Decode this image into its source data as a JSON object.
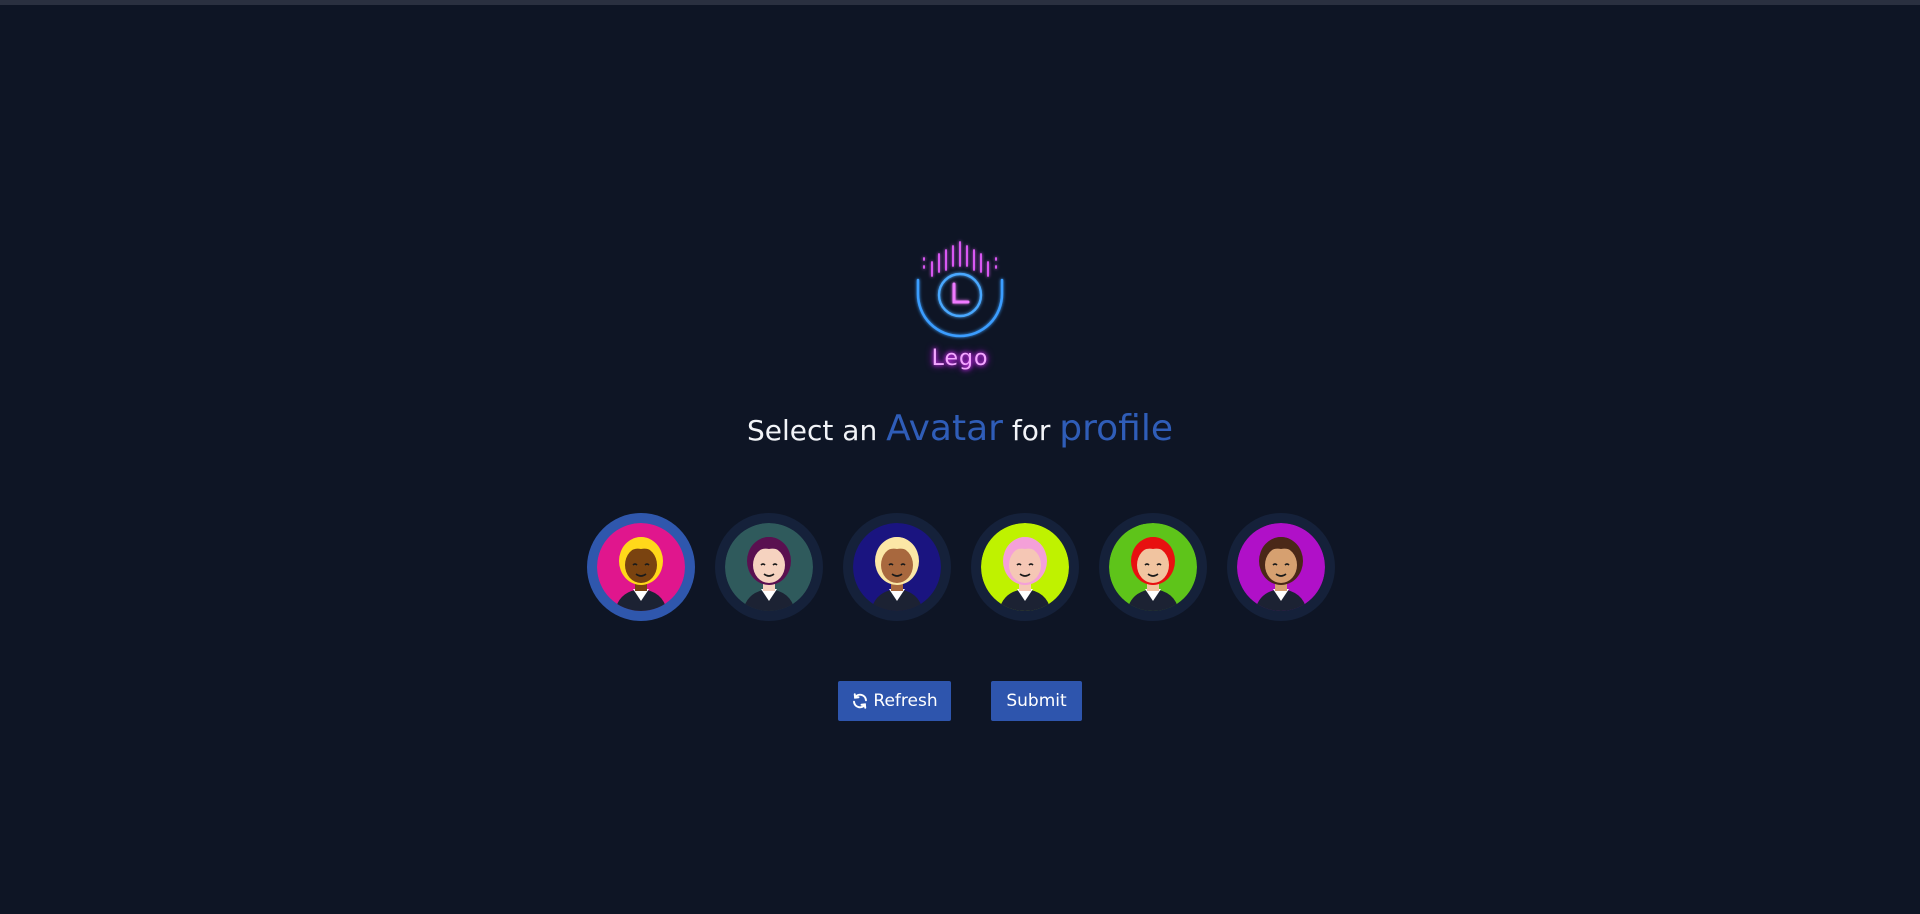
{
  "brand": {
    "name": "Lego"
  },
  "heading": {
    "part1": "Select an ",
    "accent1": "Avatar",
    "part2": " for ",
    "accent2": "profile"
  },
  "avatars": [
    {
      "bg": "#e0168d",
      "hair": "#ffd81a",
      "skin": "#7a4310",
      "selected": true
    },
    {
      "bg": "#2f5a5c",
      "hair": "#5a1050",
      "skin": "#f6d3c0",
      "selected": false
    },
    {
      "bg": "#1a1480",
      "hair": "#fbe7a6",
      "skin": "#a8683e",
      "selected": false
    },
    {
      "bg": "#bff200",
      "hair": "#f4a0d8",
      "skin": "#f5c7b5",
      "selected": false
    },
    {
      "bg": "#5ec41a",
      "hair": "#e81010",
      "skin": "#f1c4a0",
      "selected": false
    },
    {
      "bg": "#b010c8",
      "hair": "#4a2818",
      "skin": "#d6a070",
      "selected": false
    }
  ],
  "buttons": {
    "refresh_label": "Refresh",
    "refresh_icon": "refresh-icon",
    "submit_label": "Submit"
  },
  "colors": {
    "background": "#0e1525",
    "accent": "#2f5db8",
    "button": "#2e55ad",
    "logo_pink": "#e040fb",
    "logo_blue": "#3aa8ff"
  }
}
